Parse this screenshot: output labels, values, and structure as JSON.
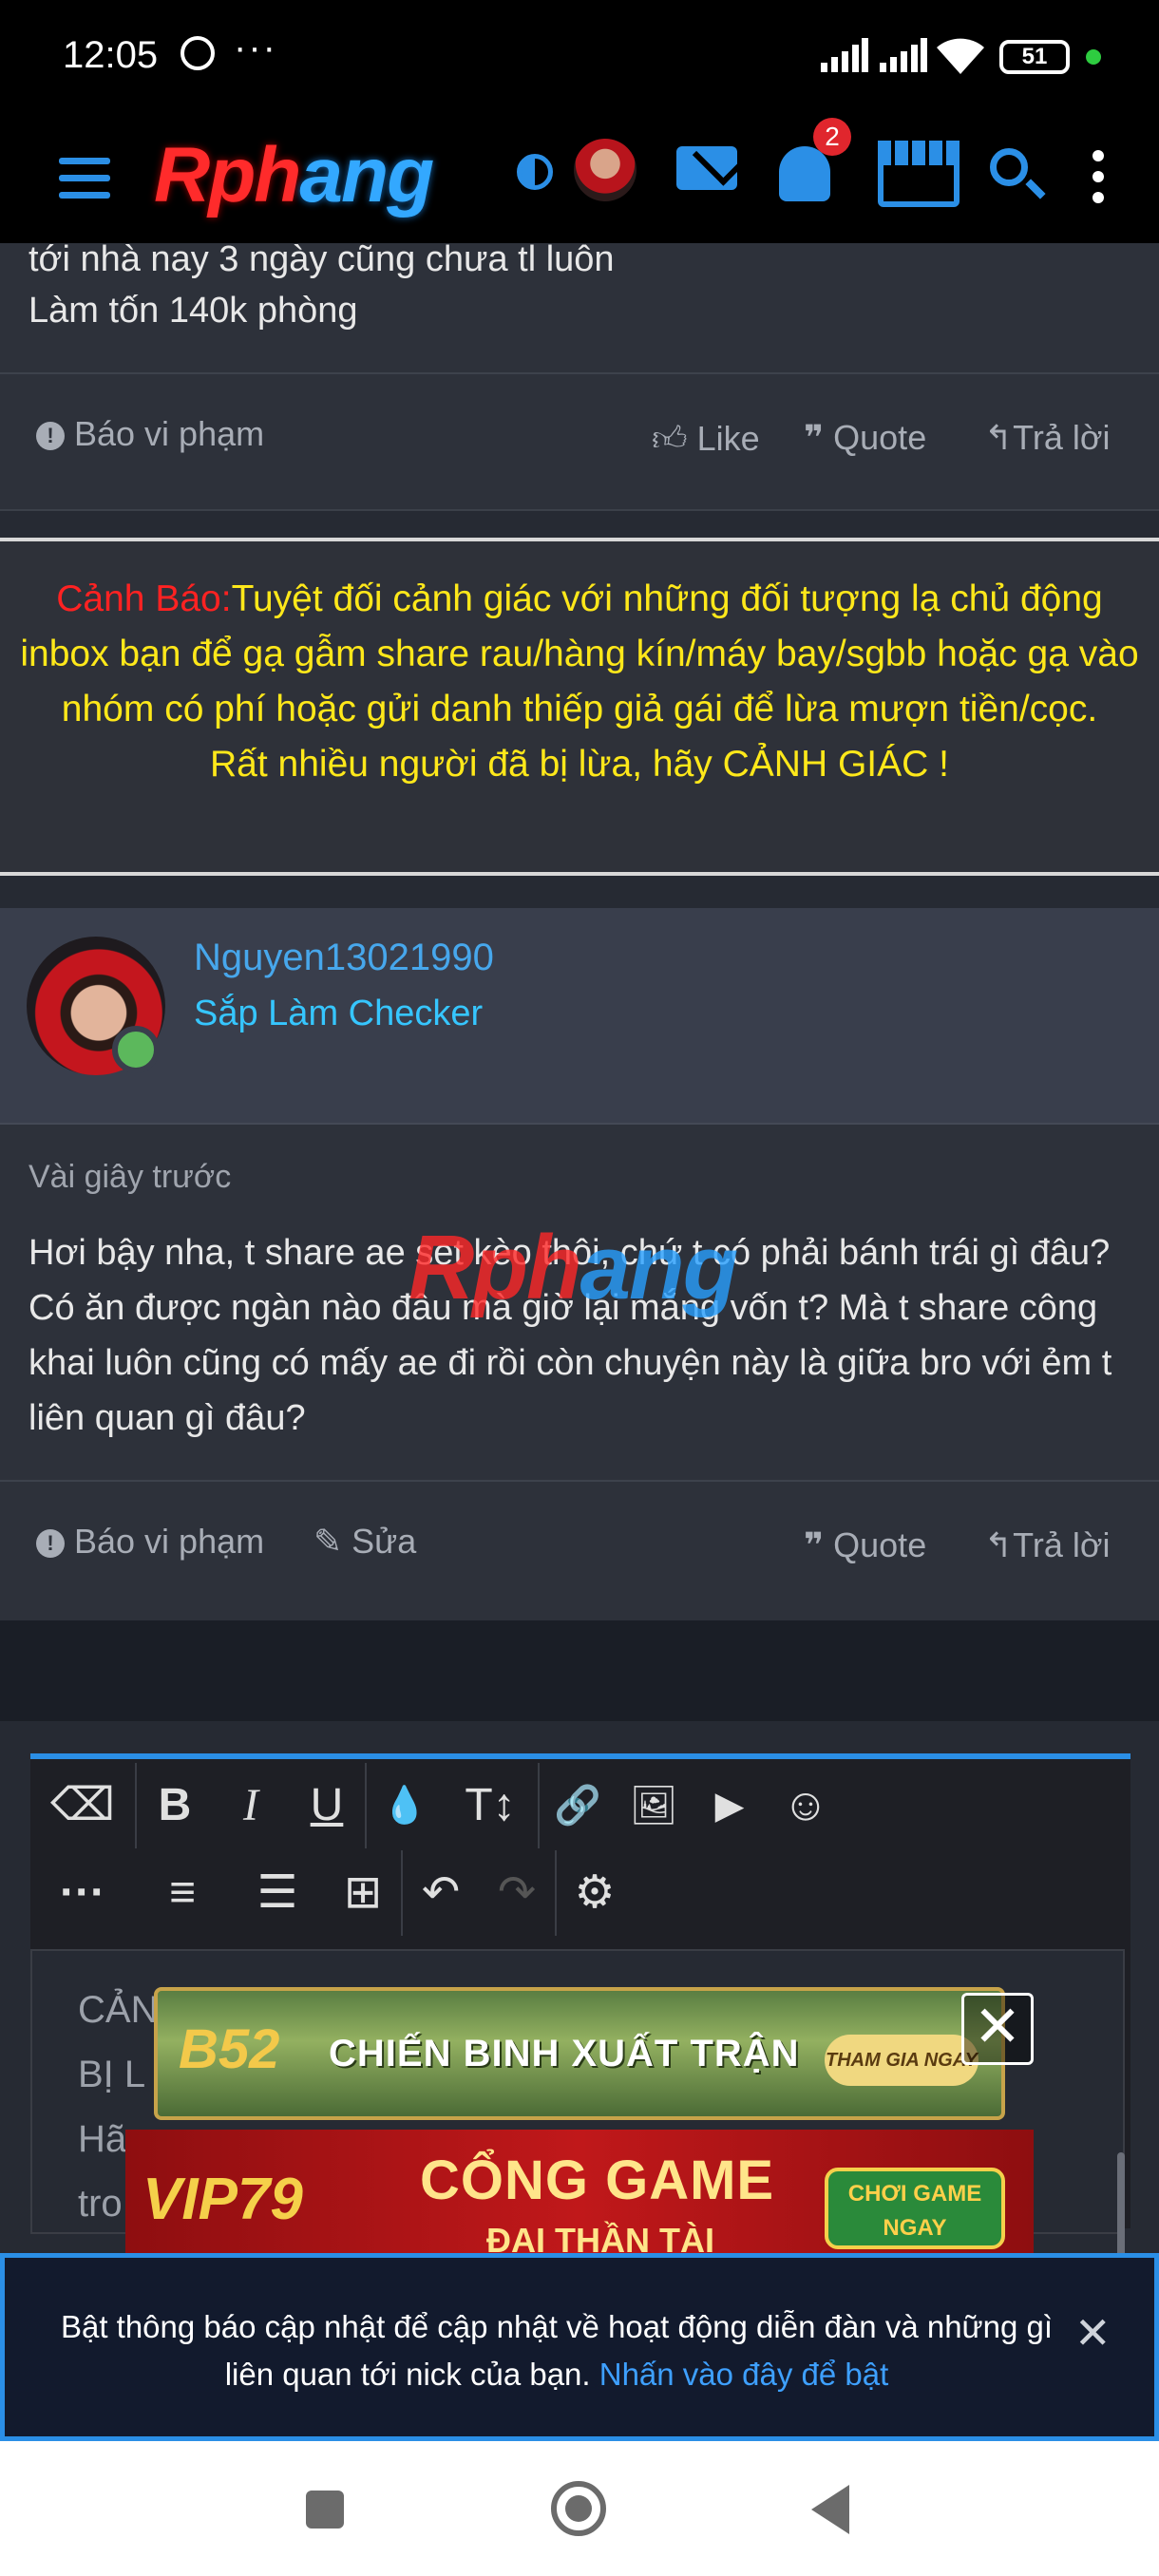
{
  "status_bar": {
    "time": "12:05",
    "more": "···",
    "battery": "51"
  },
  "header": {
    "logo_part1": "Rph",
    "logo_part2": "ang",
    "notification_count": "2"
  },
  "post1": {
    "lines": [
      "tới nhà nay 3 ngày cũng chưa tl luôn",
      "Làm tốn 140k phòng"
    ],
    "report": "Báo vi phạm",
    "like": "Like",
    "quote": "Quote",
    "reply": "Trả lời"
  },
  "warning": {
    "label": "Cảnh Báo:",
    "text1": "Tuyệt đối cảnh giác với những đối tượng lạ chủ động inbox bạn để gạ gẫm share rau/hàng kín/máy bay/sgbb hoặc gạ vào nhóm có phí hoặc gửi danh thiếp giả gái để lừa mượn tiền/cọc.",
    "text2": "Rất nhiều người đã bị lừa, hãy CẢNH GIÁC !"
  },
  "post2": {
    "username": "Nguyen13021990",
    "user_title": "Sắp Làm Checker",
    "time": "Vài giây trước",
    "body": "Hơi bậy nha, t share ae set kèo thôi, chứ t có phải bánh trái gì đâu? Có ăn được ngàn nào đâu mà giờ lại mắng vốn t? Mà t share công khai luôn cũng có mấy ae đi rồi còn chuyện này là giữa bro với ẻm t liên quan gì đâu?",
    "report": "Báo vi phạm",
    "edit": "Sửa",
    "quote": "Quote",
    "reply": "Trả lời"
  },
  "editor": {
    "draft_lines": [
      "CẢN",
      "BỊ L",
      "Hã",
      "tro"
    ],
    "toolbar": {
      "eraser": "⌫",
      "bold": "B",
      "italic": "I",
      "underline": "U",
      "color": "💧",
      "text_size": "T↕",
      "link": "🔗",
      "image": "🖼",
      "video": "▶",
      "emoji": "☺",
      "more": "···",
      "align": "≡",
      "list": "☰",
      "table": "⊞",
      "undo": "↶",
      "redo": "↷",
      "settings": "⚙"
    }
  },
  "ads": {
    "ad1_logo": "B52",
    "ad1_text": "CHIẾN BINH XUẤT TRẬN",
    "ad1_button": "THAM GIA NGAY",
    "close": "✕",
    "ad2_logo": "VIP79",
    "ad2_text": "CỔNG GAME",
    "ad2_sub": "ĐẠI THẦN TÀI",
    "ad2_button": "CHƠI GAME NGAY"
  },
  "notification": {
    "text": "Bật thông báo cập nhật để cập nhật về hoạt động diễn đàn và những gì liên quan tới nick của bạn.",
    "link": "Nhấn vào đây để bật",
    "close": "✕"
  }
}
